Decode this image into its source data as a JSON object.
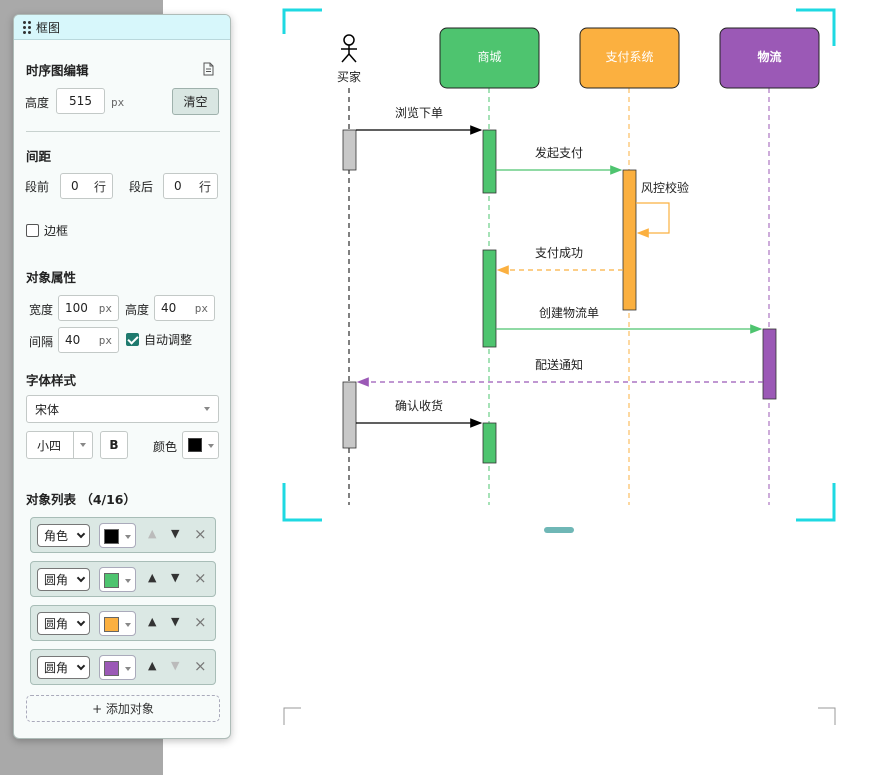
{
  "panel": {
    "title": "框图",
    "editor_title": "时序图编辑",
    "height_label": "高度",
    "height_value": "515",
    "height_unit": "px",
    "clear_label": "清空",
    "spacing_title": "间距",
    "before_label": "段前",
    "before_value": "0",
    "before_unit": "行",
    "after_label": "段后",
    "after_value": "0",
    "after_unit": "行",
    "border_label": "边框",
    "border_checked": false,
    "obj_props_title": "对象属性",
    "width_label": "宽度",
    "width_value": "100",
    "width_unit": "px",
    "obj_height_label": "高度",
    "obj_height_value": "40",
    "obj_height_unit": "px",
    "gap_label": "间隔",
    "gap_value": "40",
    "gap_unit": "px",
    "auto_label": "自动调整",
    "auto_checked": true,
    "font_style_title": "字体样式",
    "font_value": "宋体",
    "size_value": "小四",
    "bold_label": "B",
    "color_label": "颜色",
    "font_color": "#000000",
    "obj_list_title": "对象列表 （4/16）",
    "objects": [
      {
        "type": "角色",
        "color": "#000000",
        "up_enabled": false,
        "down_enabled": true
      },
      {
        "type": "圆角",
        "color": "#4ec46f",
        "up_enabled": true,
        "down_enabled": true
      },
      {
        "type": "圆角",
        "color": "#fbb040",
        "up_enabled": true,
        "down_enabled": true
      },
      {
        "type": "圆角",
        "color": "#9b59b6",
        "up_enabled": true,
        "down_enabled": false
      }
    ],
    "add_label": "+ 添加对象"
  },
  "diagram": {
    "actor": {
      "name": "买家",
      "color": "#000000"
    },
    "participants": [
      {
        "name": "商城",
        "color": "#4ec46f"
      },
      {
        "name": "支付系统",
        "color": "#fbb040"
      },
      {
        "name": "物流",
        "color": "#9b59b6"
      }
    ],
    "messages": [
      {
        "label": "浏览下单",
        "from": "买家",
        "to": "商城",
        "style": "solid"
      },
      {
        "label": "发起支付",
        "from": "商城",
        "to": "支付系统",
        "style": "solid"
      },
      {
        "label": "风控校验",
        "from": "支付系统",
        "to": "支付系统",
        "style": "self"
      },
      {
        "label": "支付成功",
        "from": "支付系统",
        "to": "商城",
        "style": "dashed"
      },
      {
        "label": "创建物流单",
        "from": "商城",
        "to": "物流",
        "style": "solid"
      },
      {
        "label": "配送通知",
        "from": "物流",
        "to": "买家",
        "style": "dashed"
      },
      {
        "label": "确认收货",
        "from": "买家",
        "to": "商城",
        "style": "solid"
      }
    ],
    "frame_color": "#1ed9e2",
    "activation_gray": "#c8c8c8"
  }
}
